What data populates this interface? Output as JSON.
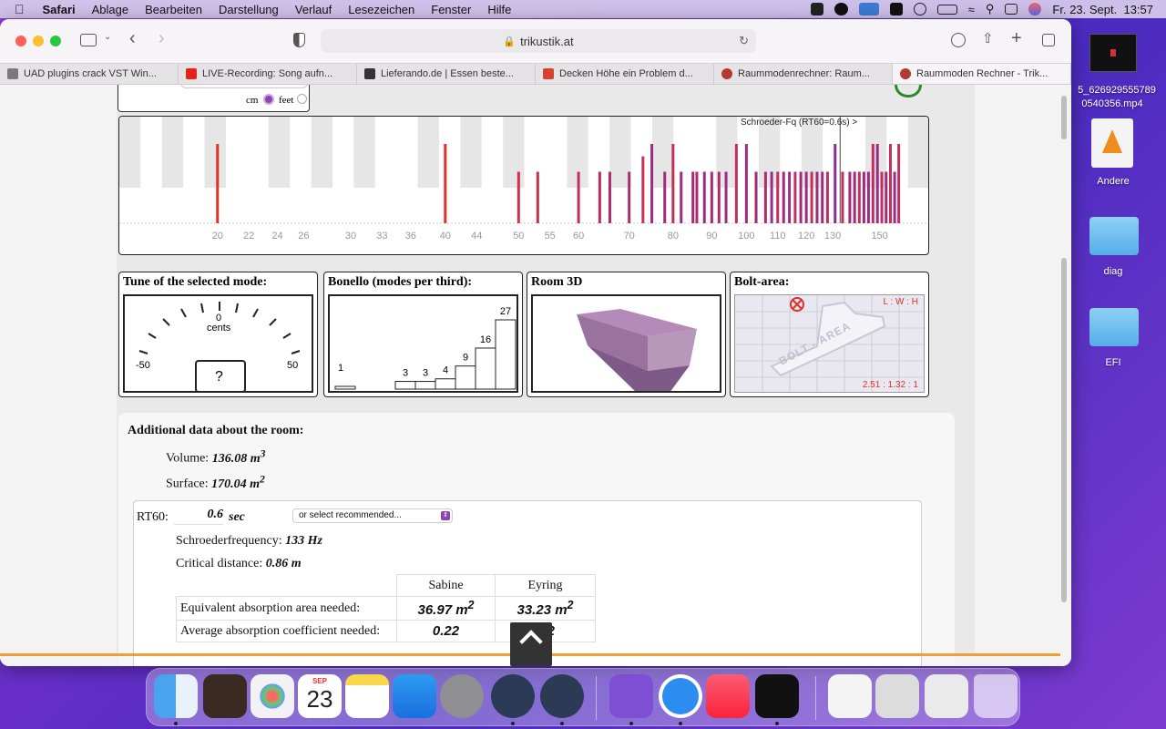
{
  "menubar": {
    "apple": "",
    "app": "Safari",
    "items": [
      "Ablage",
      "Bearbeiten",
      "Darstellung",
      "Verlauf",
      "Lesezeichen",
      "Fenster",
      "Hilfe"
    ],
    "datetime": "Fr. 23. Sept.  13:57"
  },
  "browser": {
    "url": "trikustik.at",
    "tabs": [
      {
        "label": "UAD plugins crack VST Win...",
        "color": "#7a7a7a"
      },
      {
        "label": "LIVE-Recording: Song aufn...",
        "color": "#e62117"
      },
      {
        "label": "Lieferando.de | Essen beste...",
        "color": "#333333"
      },
      {
        "label": "Decken Höhe ein Problem d...",
        "color": "#d9412f"
      },
      {
        "label": "Raummodenrechner: Raum...",
        "color": "#b23a2f"
      },
      {
        "label": "Raummoden Rechner - Trik...",
        "color": "#b23a2f"
      }
    ]
  },
  "units": {
    "cm": "cm",
    "feet": "feet",
    "selected": "cm"
  },
  "spectrum": {
    "schroeder_label": "Schroeder-Fq (RT60=0.6s) >",
    "ticks": [
      "20",
      "22",
      "24",
      "26",
      "30",
      "33",
      "36",
      "40",
      "44",
      "50",
      "55",
      "60",
      "70",
      "80",
      "90",
      "100",
      "110",
      "120",
      "130",
      "150"
    ],
    "tick_values": [
      20,
      22,
      24,
      26,
      30,
      33,
      36,
      40,
      44,
      50,
      55,
      60,
      70,
      80,
      90,
      100,
      110,
      120,
      130,
      150
    ],
    "modes": [
      {
        "f": 20,
        "h": 0.77,
        "c": "#e0302a"
      },
      {
        "f": 40,
        "h": 0.77,
        "c": "#e0302a"
      },
      {
        "f": 50,
        "h": 0.5,
        "c": "#d03048"
      },
      {
        "f": 53,
        "h": 0.5,
        "c": "#c83050"
      },
      {
        "f": 60,
        "h": 0.5,
        "c": "#c03058"
      },
      {
        "f": 64,
        "h": 0.5,
        "c": "#b82c60"
      },
      {
        "f": 66,
        "h": 0.5,
        "c": "#b02c68"
      },
      {
        "f": 70,
        "h": 0.5,
        "c": "#a82c70"
      },
      {
        "f": 73,
        "h": 0.65,
        "c": "#c8305c"
      },
      {
        "f": 75,
        "h": 0.77,
        "c": "#9a2c88"
      },
      {
        "f": 78,
        "h": 0.5,
        "c": "#a02c78"
      },
      {
        "f": 80,
        "h": 0.77,
        "c": "#c0305c"
      },
      {
        "f": 82,
        "h": 0.5,
        "c": "#9a2c88"
      },
      {
        "f": 85,
        "h": 0.5,
        "c": "#a02c78"
      },
      {
        "f": 86,
        "h": 0.5,
        "c": "#b02c68"
      },
      {
        "f": 88,
        "h": 0.5,
        "c": "#9a2c88"
      },
      {
        "f": 90,
        "h": 0.5,
        "c": "#a82c70"
      },
      {
        "f": 92,
        "h": 0.5,
        "c": "#b02c68"
      },
      {
        "f": 94,
        "h": 0.5,
        "c": "#9a2c88"
      },
      {
        "f": 97,
        "h": 0.77,
        "c": "#c0305c"
      },
      {
        "f": 100,
        "h": 0.77,
        "c": "#9a2c88"
      },
      {
        "f": 103,
        "h": 0.5,
        "c": "#a02c78"
      },
      {
        "f": 106,
        "h": 0.5,
        "c": "#b02c68"
      },
      {
        "f": 108,
        "h": 0.5,
        "c": "#9a2c88"
      },
      {
        "f": 110,
        "h": 0.5,
        "c": "#c0305c"
      },
      {
        "f": 112,
        "h": 0.5,
        "c": "#a02c78"
      },
      {
        "f": 114,
        "h": 0.5,
        "c": "#9a2c88"
      },
      {
        "f": 116,
        "h": 0.5,
        "c": "#c0305c"
      },
      {
        "f": 118,
        "h": 0.5,
        "c": "#a02c78"
      },
      {
        "f": 120,
        "h": 0.5,
        "c": "#9a2c88"
      },
      {
        "f": 122,
        "h": 0.5,
        "c": "#c0305c"
      },
      {
        "f": 124,
        "h": 0.5,
        "c": "#a02c78"
      },
      {
        "f": 126,
        "h": 0.5,
        "c": "#9a2c88"
      },
      {
        "f": 128,
        "h": 0.5,
        "c": "#c0305c"
      },
      {
        "f": 131,
        "h": 0.77,
        "c": "#8a2c98"
      },
      {
        "f": 134,
        "h": 0.5,
        "c": "#c0305c"
      },
      {
        "f": 137,
        "h": 0.5,
        "c": "#a02c78"
      },
      {
        "f": 139,
        "h": 0.5,
        "c": "#9a2c88"
      },
      {
        "f": 141,
        "h": 0.5,
        "c": "#c0305c"
      },
      {
        "f": 143,
        "h": 0.5,
        "c": "#a02c78"
      },
      {
        "f": 145,
        "h": 0.5,
        "c": "#9a2c88"
      },
      {
        "f": 147,
        "h": 0.77,
        "c": "#c0305c"
      },
      {
        "f": 149,
        "h": 0.77,
        "c": "#9a2c88"
      },
      {
        "f": 151,
        "h": 0.5,
        "c": "#c0305c"
      },
      {
        "f": 153,
        "h": 0.5,
        "c": "#a02c78"
      },
      {
        "f": 155,
        "h": 0.77,
        "c": "#c0305c"
      },
      {
        "f": 157,
        "h": 0.5,
        "c": "#9a2c88"
      },
      {
        "f": 159,
        "h": 0.77,
        "c": "#c0305c"
      }
    ]
  },
  "tune": {
    "title": "Tune of the selected mode:",
    "center": "0",
    "unit": "cents",
    "left": "-50",
    "right": "50",
    "value": "?"
  },
  "bonello": {
    "title": "Bonello (modes per third):",
    "values": [
      1,
      0,
      0,
      3,
      3,
      4,
      9,
      16,
      27
    ],
    "labels": [
      "1",
      "",
      "",
      "3",
      "3",
      "4",
      "9",
      "16",
      "27"
    ]
  },
  "room3d": {
    "title": "Room 3D"
  },
  "bolt": {
    "title": "Bolt-area:",
    "header": "L : W : H",
    "ratio": "2.51 : 1.32 : 1",
    "watermark": "BOLT - AREA"
  },
  "additional": {
    "title": "Additional data about the room:",
    "volume_label": "Volume:",
    "volume_value": "136.08 m",
    "volume_sup": "3",
    "surface_label": "Surface:",
    "surface_value": "170.04 m",
    "surface_sup": "2",
    "rt60_label": "RT60:",
    "rt60_value": "0.6",
    "rt60_unit": "sec",
    "rt60_select": "or select recommended...",
    "schroeder_label": "Schroederfrequency:",
    "schroeder_value": "133 Hz",
    "critical_label": "Critical distance:",
    "critical_value": "0.86 m",
    "table": {
      "headers": [
        "",
        "Sabine",
        "Eyring"
      ],
      "rows": [
        {
          "label": "Equivalent absorption area needed:",
          "sabine": "36.97 m",
          "sabine_sup": "2",
          "eyring": "33.23 m",
          "eyring_sup": "2"
        },
        {
          "label": "Average absorption coefficient needed:",
          "sabine": "0.22",
          "eyring": "0.2"
        }
      ]
    }
  },
  "desktop": {
    "file_label_1": "5_626929555789",
    "file_label_2": "0540356.mp4",
    "andere": "Andere",
    "diag": "diag",
    "efi": "EFI"
  },
  "dock": {
    "calendar_month": "SEP",
    "calendar_day": "23"
  },
  "colors": {
    "accent": "#8e44ad",
    "schroeder": "#c0305c",
    "low_mode": "#e0302a"
  }
}
